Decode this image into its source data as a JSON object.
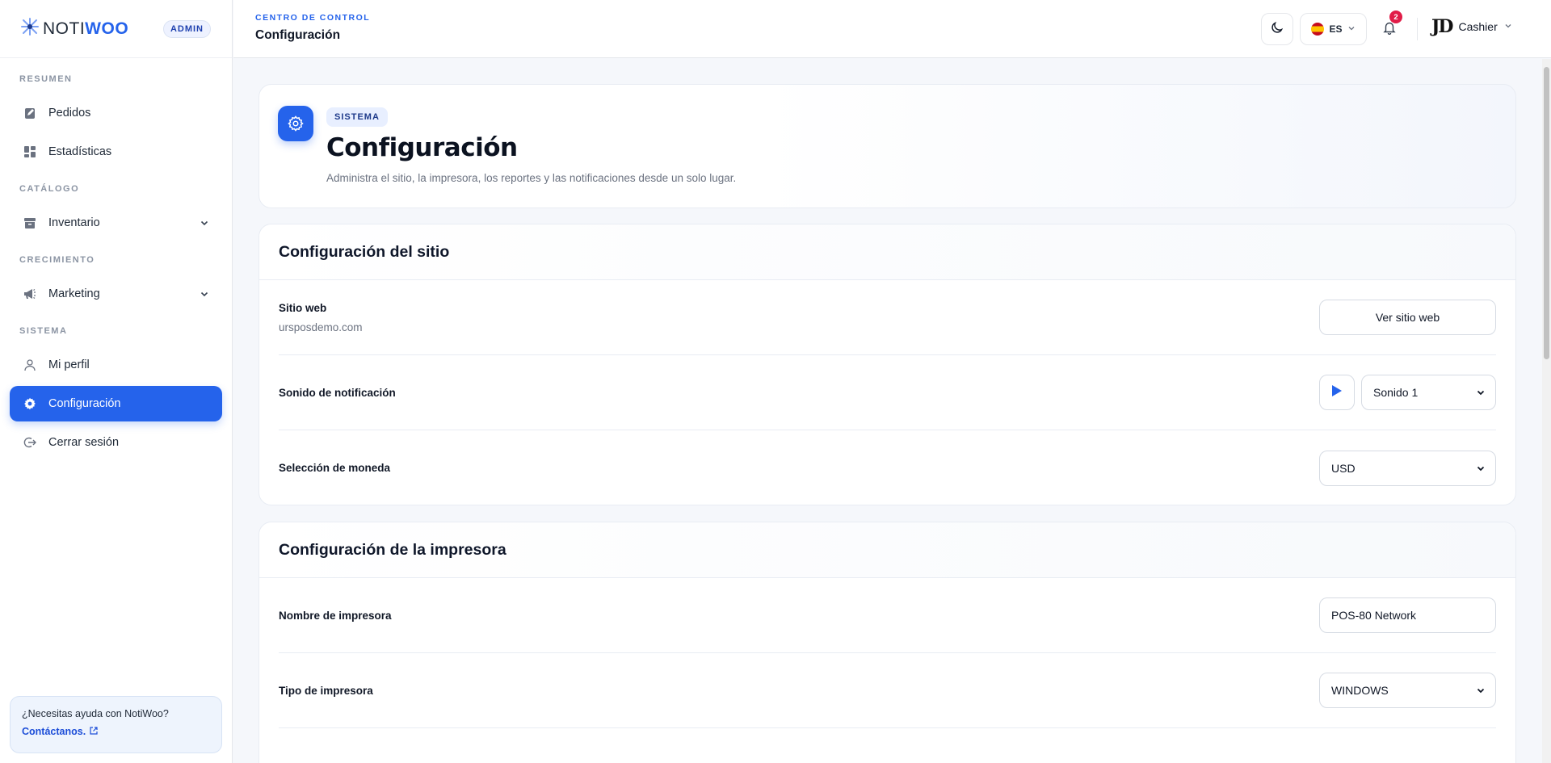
{
  "brand": {
    "noti": "NOTI",
    "woo": "WOO",
    "badge": "ADMIN"
  },
  "sidebar": {
    "sections": [
      {
        "title": "RESUMEN"
      },
      {
        "title": "CATÁLOGO"
      },
      {
        "title": "CRECIMIENTO"
      },
      {
        "title": "SISTEMA"
      }
    ],
    "items": {
      "pedidos": "Pedidos",
      "estadisticas": "Estadísticas",
      "inventario": "Inventario",
      "marketing": "Marketing",
      "perfil": "Mi perfil",
      "configuracion": "Configuración",
      "logout": "Cerrar sesión"
    },
    "help": {
      "question": "¿Necesitas ayuda con NotiWoo?",
      "link": "Contáctanos."
    }
  },
  "topbar": {
    "section": "CENTRO DE CONTROL",
    "title": "Configuración",
    "language": "ES",
    "notification_count": "2",
    "avatar": "JD",
    "user": "Cashier"
  },
  "hero": {
    "tag": "SISTEMA",
    "title": "Configuración",
    "description": "Administra el sitio, la impresora, los reportes y las notificaciones desde un solo lugar."
  },
  "site_settings": {
    "title": "Configuración del sitio",
    "website_label": "Sitio web",
    "website_value": "ursposdemo.com",
    "website_button": "Ver sitio web",
    "sound_label": "Sonido de notificación",
    "sound_value": "Sonido 1",
    "currency_label": "Selección de moneda",
    "currency_value": "USD"
  },
  "printer_settings": {
    "title": "Configuración de la impresora",
    "name_label": "Nombre de impresora",
    "name_value": "POS-80 Network",
    "type_label": "Tipo de impresora",
    "type_value": "WINDOWS"
  },
  "colors": {
    "accent": "#2563eb",
    "badge": "#e11d48"
  }
}
